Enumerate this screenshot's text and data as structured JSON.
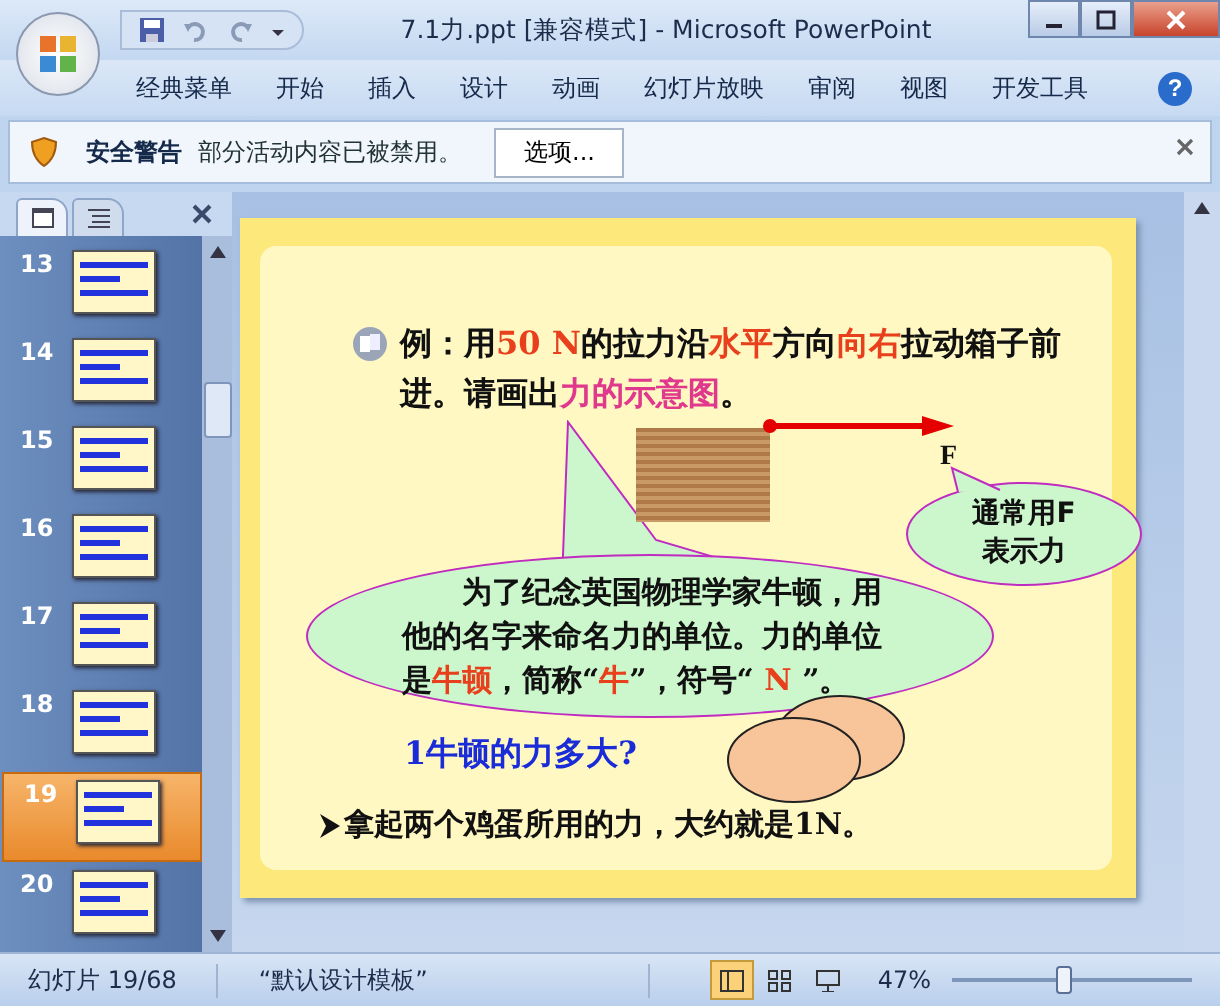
{
  "window": {
    "title": "7.1力.ppt [兼容模式] - Microsoft PowerPoint"
  },
  "help_label": "?",
  "ribbon_tabs": [
    {
      "label": "经典菜单",
      "selected": false
    },
    {
      "label": "开始",
      "selected": false
    },
    {
      "label": "插入",
      "selected": false
    },
    {
      "label": "设计",
      "selected": false
    },
    {
      "label": "动画",
      "selected": false
    },
    {
      "label": "幻灯片放映",
      "selected": false
    },
    {
      "label": "审阅",
      "selected": false
    },
    {
      "label": "视图",
      "selected": false
    },
    {
      "label": "开发工具",
      "selected": false
    }
  ],
  "security_bar": {
    "title": "安全警告",
    "message": "部分活动内容已被禁用。",
    "button": "选项..."
  },
  "panel_tabs": [
    {
      "kind": "slides",
      "selected": true
    },
    {
      "kind": "outline",
      "selected": false
    }
  ],
  "slides": [
    {
      "number": "13",
      "selected": false
    },
    {
      "number": "14",
      "selected": false
    },
    {
      "number": "15",
      "selected": false
    },
    {
      "number": "16",
      "selected": false
    },
    {
      "number": "17",
      "selected": false
    },
    {
      "number": "18",
      "selected": false
    },
    {
      "number": "19",
      "selected": true
    },
    {
      "number": "20",
      "selected": false
    }
  ],
  "slide": {
    "example": [
      {
        "text": "例：用",
        "kind": "plain"
      },
      {
        "text": "50 N",
        "kind": "red"
      },
      {
        "text": "的拉力沿",
        "kind": "plain"
      },
      {
        "text": "水平",
        "kind": "red"
      },
      {
        "text": "方向",
        "kind": "plain"
      },
      {
        "text": "向右",
        "kind": "red"
      },
      {
        "text": "拉动箱子前进。请画出",
        "kind": "plain"
      },
      {
        "text": "力的示意图",
        "kind": "pink"
      },
      {
        "text": "。",
        "kind": "plain"
      }
    ],
    "force_label": "F",
    "small_bubble": "通常用F表示力",
    "big_bubble": [
      {
        "text": "为了纪念英国物理学家牛顿，用他的名字来命名力的单位。力的单位是",
        "kind": "plain"
      },
      {
        "text": "牛顿",
        "kind": "red"
      },
      {
        "text": "，简称“",
        "kind": "plain"
      },
      {
        "text": "牛",
        "kind": "red"
      },
      {
        "text": "”，符号“ ",
        "kind": "plain"
      },
      {
        "text": "N",
        "kind": "red"
      },
      {
        "text": " ”。",
        "kind": "plain"
      }
    ],
    "question": "1牛顿的力多大?",
    "bullet": "拿起两个鸡蛋所用的力，大约就是1N。"
  },
  "status_bar": {
    "slide_count": "幻灯片 19/68",
    "theme": "“默认设计模板”",
    "views": [
      {
        "kind": "normal",
        "selected": true
      },
      {
        "kind": "sorter",
        "selected": false
      },
      {
        "kind": "show",
        "selected": false
      }
    ],
    "zoom": "47%",
    "zoom_slider": {
      "level": 0.47
    }
  }
}
